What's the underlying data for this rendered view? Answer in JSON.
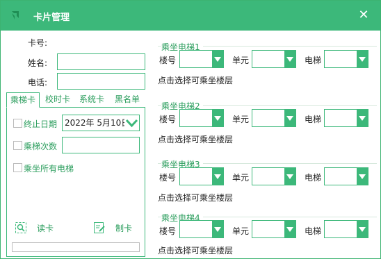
{
  "window": {
    "title": "卡片管理",
    "close_glyph": "✕"
  },
  "form": {
    "card_no_label": "卡号:",
    "name_label": "姓名:",
    "phone_label": "电话:",
    "name_value": "",
    "phone_value": ""
  },
  "tabs": [
    {
      "label": "乘梯卡",
      "active": true
    },
    {
      "label": "校时卡",
      "active": false
    },
    {
      "label": "系统卡",
      "active": false
    },
    {
      "label": "黑名单",
      "active": false
    }
  ],
  "options": {
    "end_date_label": "终止日期",
    "end_date_value": "2022年  5月10日",
    "ride_count_label": "乘梯次数",
    "ride_count_value": "",
    "all_elevators_label": "乘坐所有电梯"
  },
  "actions": {
    "read_label": "读卡",
    "make_label": "制卡"
  },
  "groups": [
    {
      "title": "乘坐电梯1",
      "building_label": "楼号",
      "unit_label": "单元",
      "elevator_label": "电梯",
      "hint": "点击选择可乘坐楼层"
    },
    {
      "title": "乘坐电梯2",
      "building_label": "楼号",
      "unit_label": "单元",
      "elevator_label": "电梯",
      "hint": "点击选择可乘坐楼层"
    },
    {
      "title": "乘坐电梯3",
      "building_label": "楼号",
      "unit_label": "单元",
      "elevator_label": "电梯",
      "hint": "点击选择可乘坐楼层"
    },
    {
      "title": "乘坐电梯4",
      "building_label": "楼号",
      "unit_label": "单元",
      "elevator_label": "电梯",
      "hint": "点击选择可乘坐楼层"
    }
  ],
  "colors": {
    "accent": "#3cb87a",
    "accent_text": "#2a9d5c"
  }
}
